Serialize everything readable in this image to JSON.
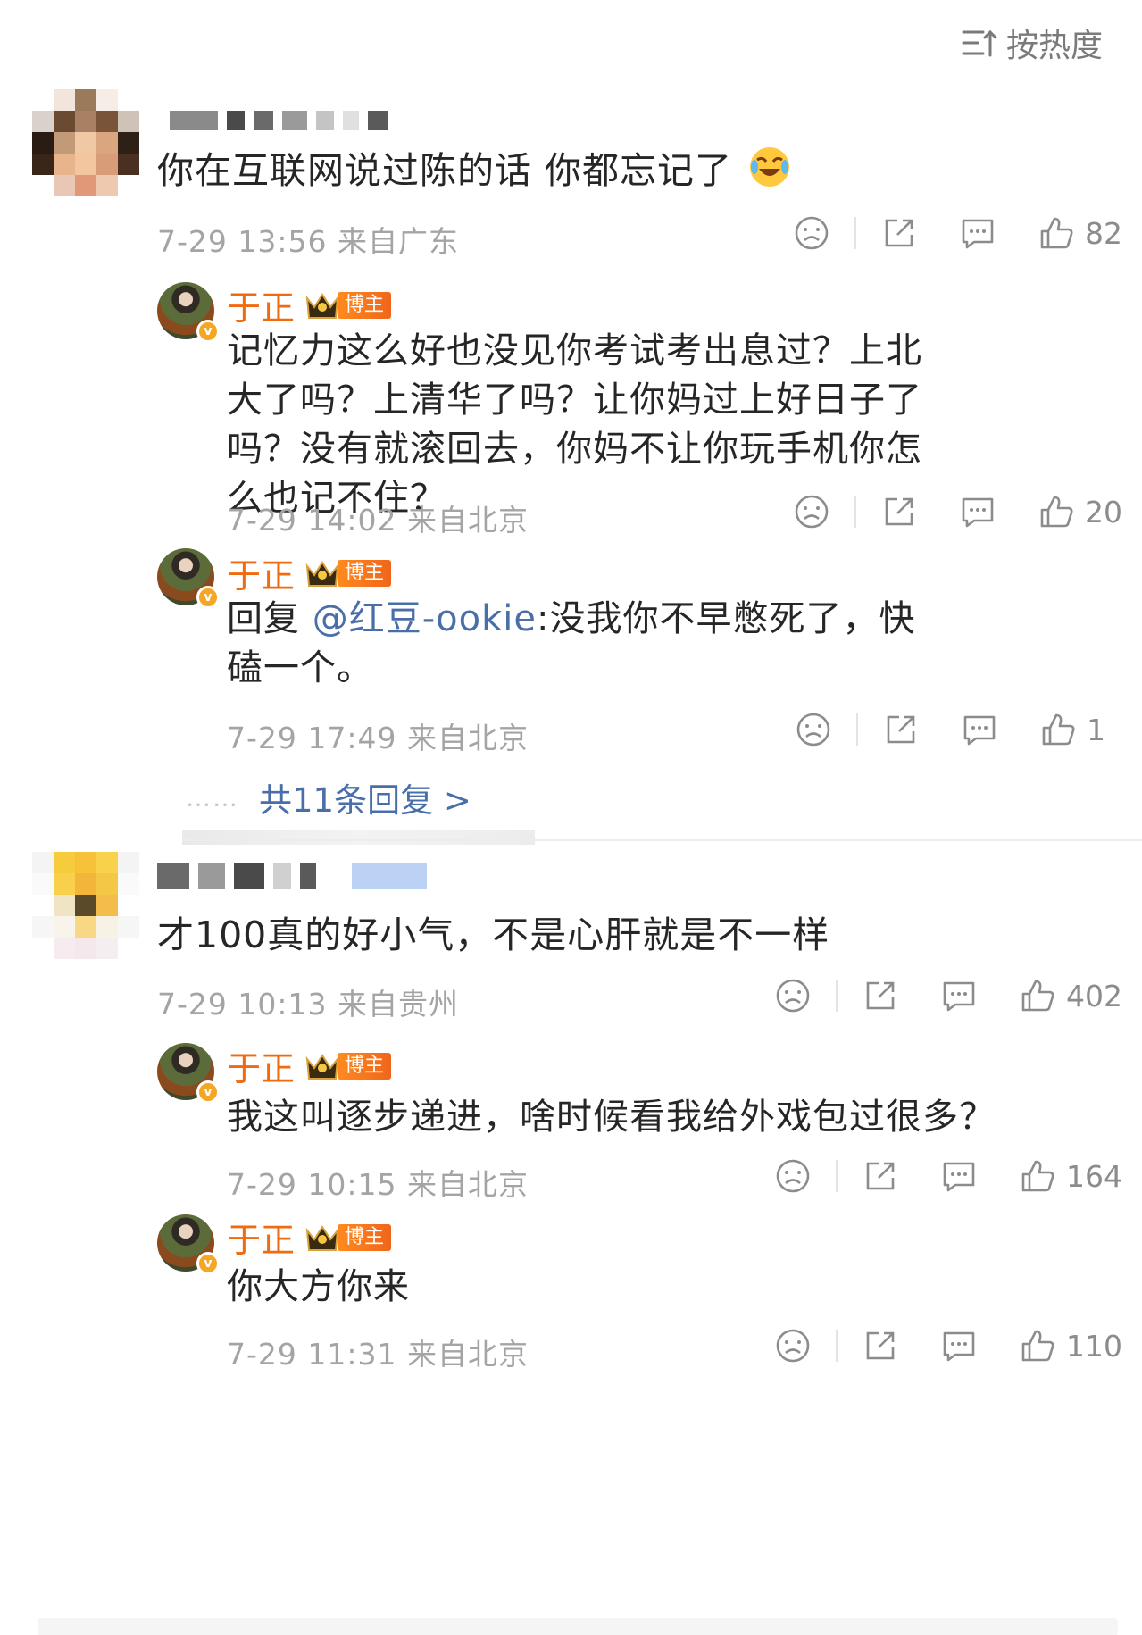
{
  "sort": {
    "label": "按热度",
    "icon": "sort-icon"
  },
  "more_replies_1": {
    "dots": "……",
    "label": "共11条回复 >"
  },
  "comments": [
    {
      "text": "你在互联网说过陈的话 你都忘记了",
      "emoji": "laugh-cry-emoji",
      "meta": "7-29 13:56 来自广东",
      "likes": "82",
      "replies": [
        {
          "author": "于正",
          "tag": "博主",
          "text": "记忆力这么好也没见你考试考出息过？上北大了吗？上清华了吗？让你妈过上好日子了吗？没有就滚回去，你妈不让你玩手机你怎么也记不住？",
          "meta": "7-29 14:02 来自北京",
          "likes": "20"
        },
        {
          "author": "于正",
          "tag": "博主",
          "reply_prefix": "回复 ",
          "mention": "@红豆-ookie",
          "text": ":没我你不早憋死了，快磕一个。",
          "meta": "7-29 17:49 来自北京",
          "likes": "1"
        }
      ]
    },
    {
      "text": "才100真的好小气，不是心肝就是不一样",
      "meta": "7-29 10:13 来自贵州",
      "likes": "402",
      "replies": [
        {
          "author": "于正",
          "tag": "博主",
          "text": "我这叫逐步递进，啥时候看我给外戏包过很多？",
          "meta": "7-29 10:15 来自北京",
          "likes": "164"
        },
        {
          "author": "于正",
          "tag": "博主",
          "text": "你大方你来",
          "meta": "7-29 11:31 来自北京",
          "likes": "110"
        }
      ]
    }
  ],
  "colors": {
    "accent_orange": "#f06a0f",
    "link_blue": "#4a6fa8",
    "meta_gray": "#a4a4a4"
  }
}
